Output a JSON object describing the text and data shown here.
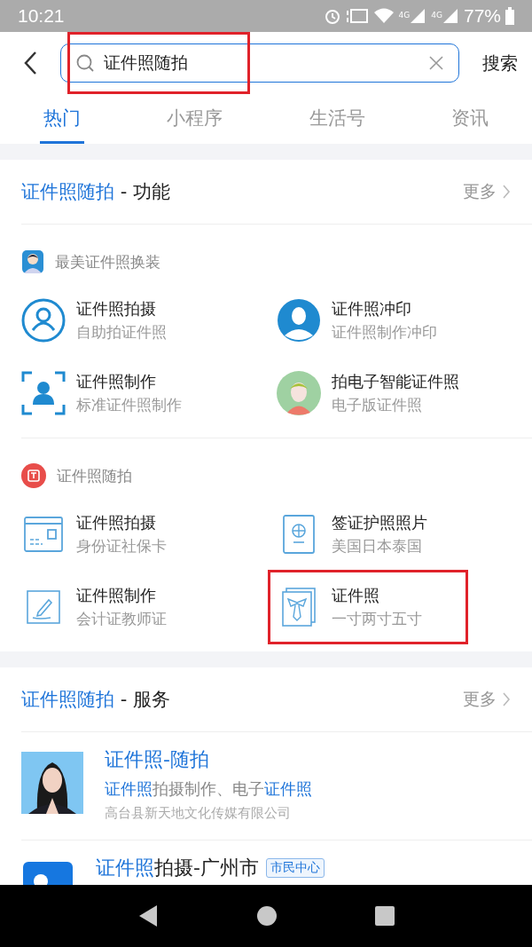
{
  "status_bar": {
    "time": "10:21",
    "battery": "77%",
    "network_1": "4G",
    "network_2": "4G"
  },
  "search": {
    "value": "证件照随拍",
    "button": "搜索",
    "highlighted": true
  },
  "tabs": [
    {
      "label": "热门",
      "selected": true
    },
    {
      "label": "小程序",
      "selected": false
    },
    {
      "label": "生活号",
      "selected": false
    },
    {
      "label": "资讯",
      "selected": false
    }
  ],
  "function_section": {
    "title": [
      {
        "text": "证件照随拍",
        "highlight": true
      },
      {
        "text": " - 功能",
        "highlight": false
      }
    ],
    "more": "更多",
    "groups": [
      {
        "name": "最美证件照换装",
        "items": [
          {
            "title": "证件照拍摄",
            "subtitle": "自助拍证件照",
            "highlighted": false
          },
          {
            "title": "证件照冲印",
            "subtitle": "证件照制作冲印",
            "highlighted": false
          },
          {
            "title": "证件照制作",
            "subtitle": "标准证件照制作",
            "highlighted": false
          },
          {
            "title": "拍电子智能证件照",
            "subtitle": "电子版证件照",
            "highlighted": false
          }
        ]
      },
      {
        "name": "证件照随拍",
        "items": [
          {
            "title": "证件照拍摄",
            "subtitle": "身份证社保卡",
            "highlighted": false
          },
          {
            "title": "签证护照照片",
            "subtitle": "美国日本泰国",
            "highlighted": false
          },
          {
            "title": "证件照制作",
            "subtitle": "会计证教师证",
            "highlighted": false
          },
          {
            "title": "证件照",
            "subtitle": "一寸两寸五寸",
            "highlighted": true
          }
        ]
      }
    ]
  },
  "service_section": {
    "title": [
      {
        "text": "证件照随拍",
        "highlight": true
      },
      {
        "text": " - 服务",
        "highlight": false
      }
    ],
    "more": "更多",
    "items": [
      {
        "kind": "picture",
        "title": [
          {
            "text": "证件照-随拍",
            "highlight": true
          }
        ],
        "description": [
          {
            "text": "证件照",
            "highlight": true
          },
          {
            "text": "拍摄制作、电子",
            "highlight": false
          },
          {
            "text": "证件照",
            "highlight": true
          }
        ],
        "provider": "高台县新天地文化传媒有限公司"
      },
      {
        "kind": "app",
        "title": [
          {
            "text": "证件照",
            "highlight": true
          },
          {
            "text": "拍摄-广州市",
            "highlight": false
          }
        ],
        "badge": "市民中心"
      }
    ]
  }
}
